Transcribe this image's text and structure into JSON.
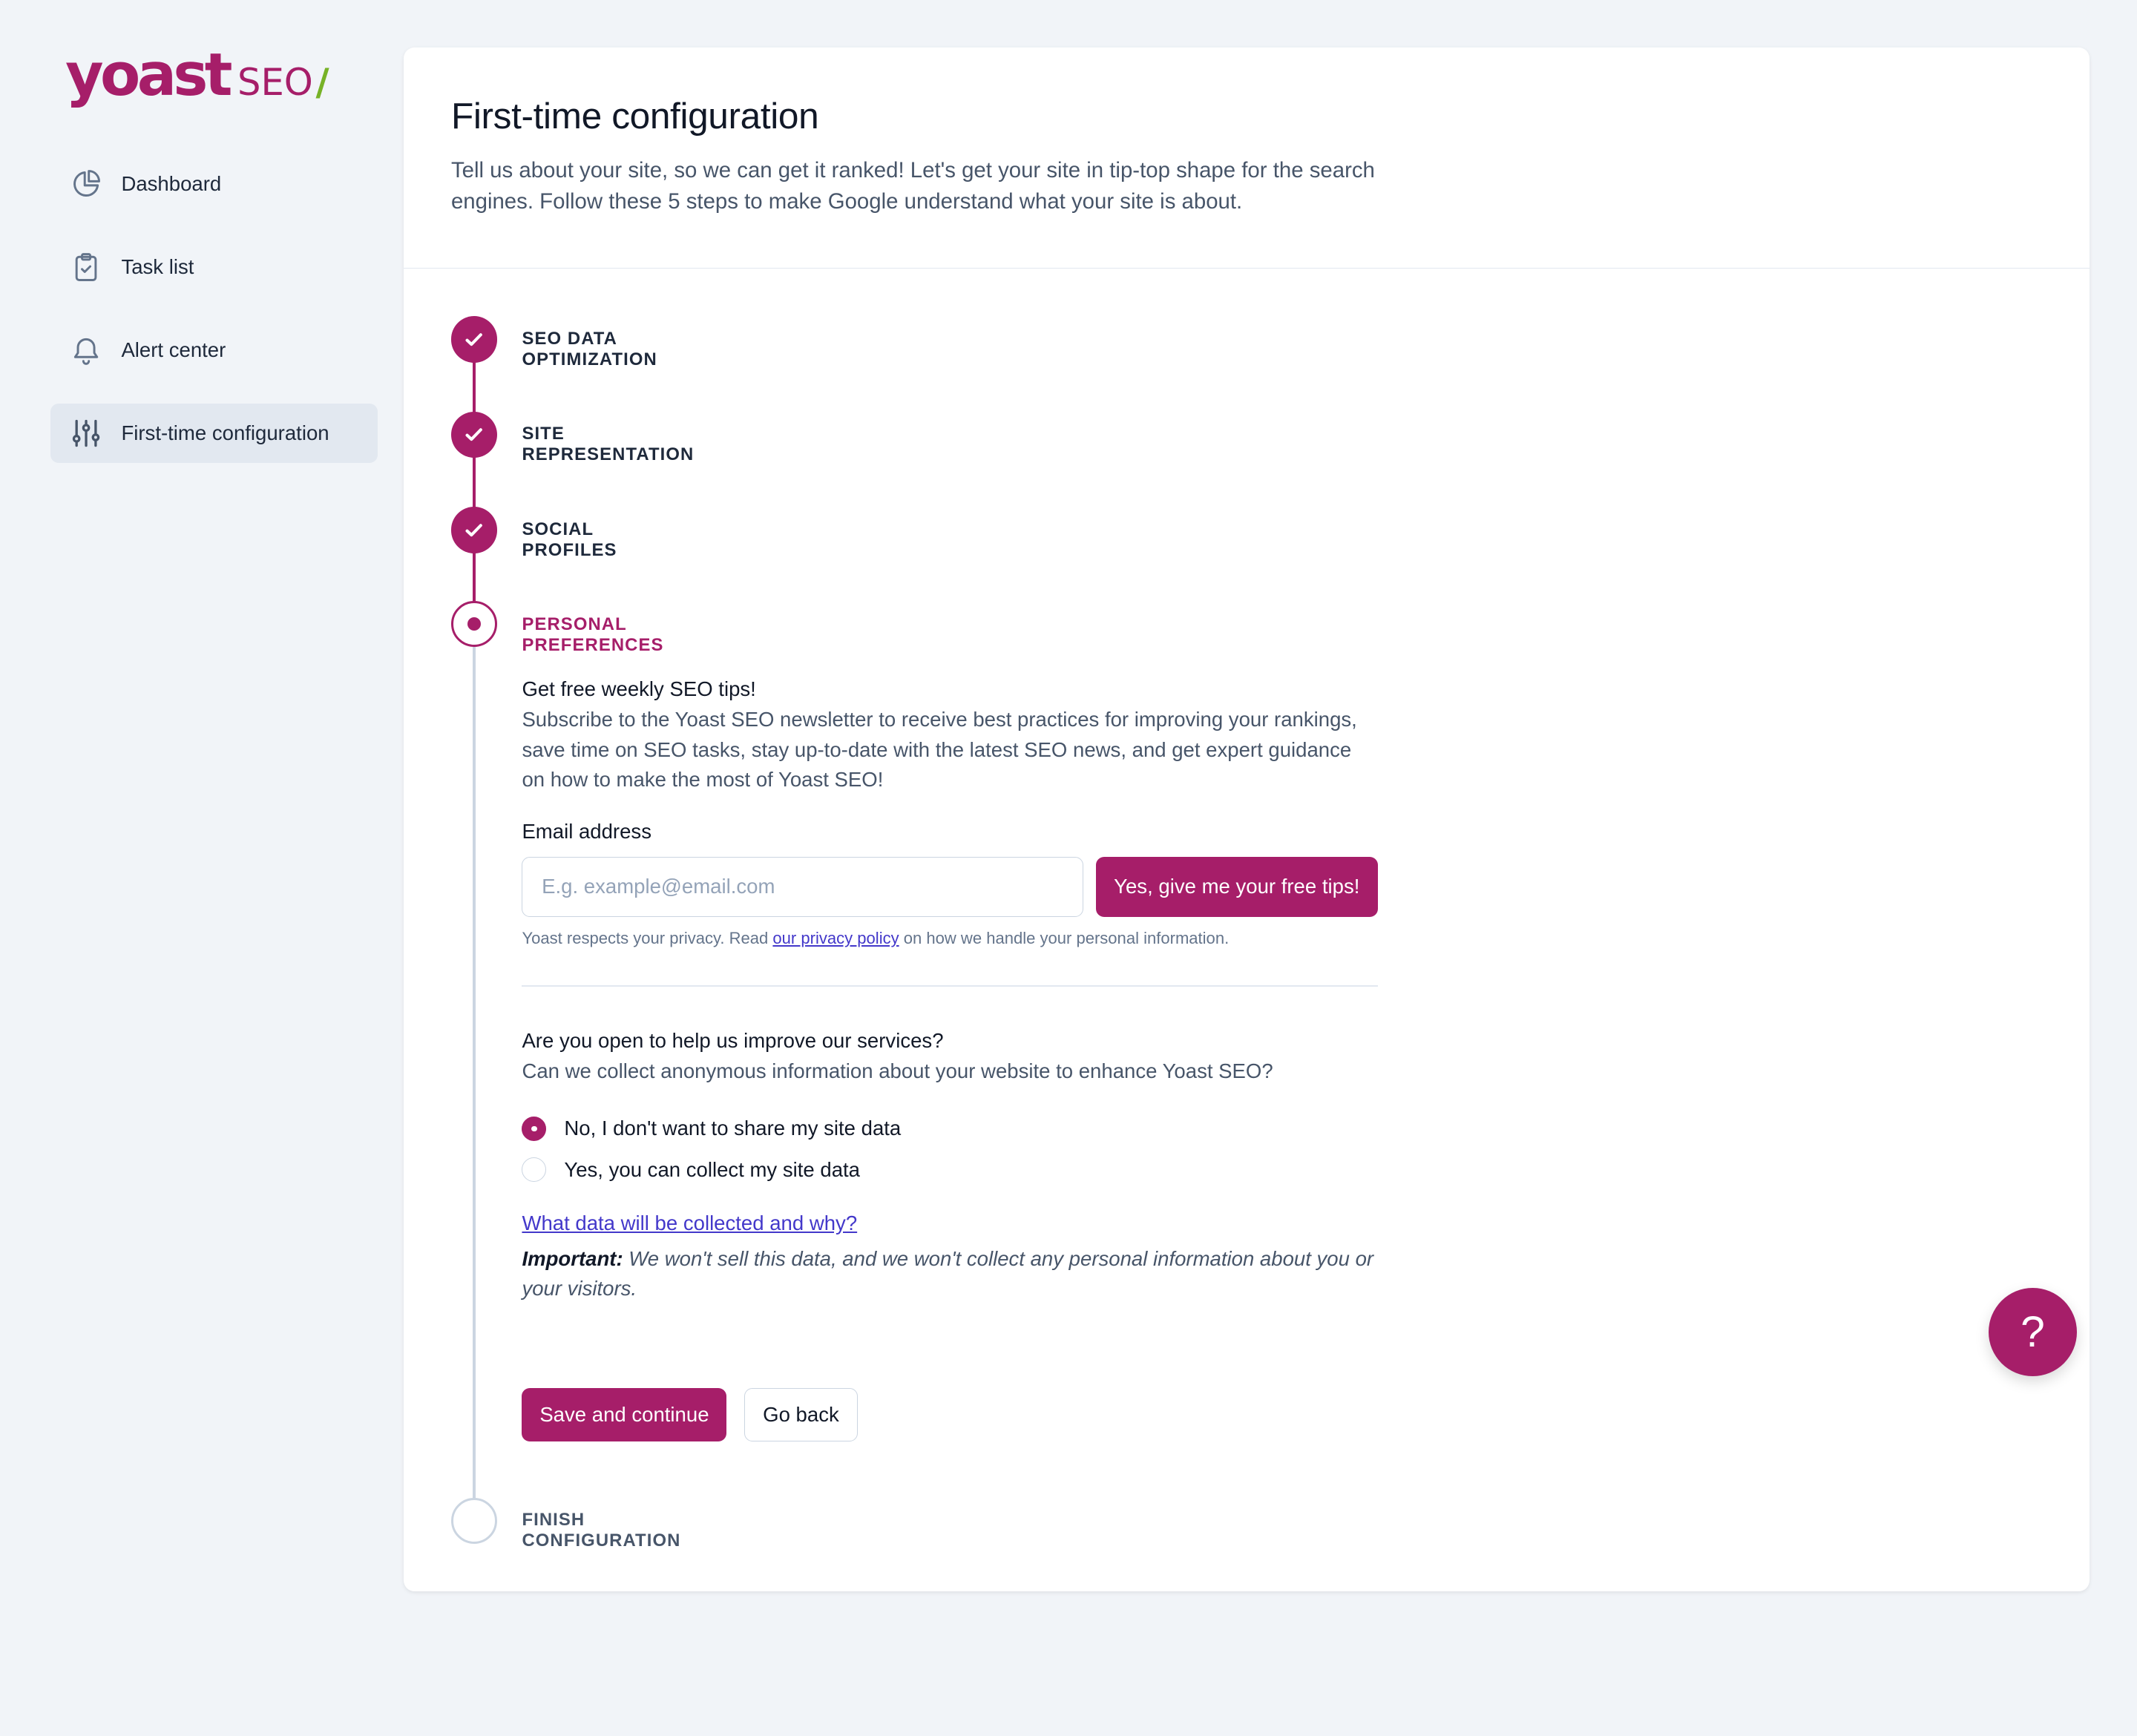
{
  "brand": {
    "name": "yoast",
    "product": "SEO",
    "slash": "/",
    "accent": "#a61e69",
    "slash_color": "#77b227"
  },
  "sidebar": {
    "items": [
      {
        "label": "Dashboard",
        "icon": "pie-chart-icon",
        "active": false
      },
      {
        "label": "Task list",
        "icon": "clipboard-check-icon",
        "active": false
      },
      {
        "label": "Alert center",
        "icon": "bell-icon",
        "active": false
      },
      {
        "label": "First-time configuration",
        "icon": "sliders-icon",
        "active": true
      }
    ]
  },
  "header": {
    "title": "First-time configuration",
    "description": "Tell us about your site, so we can get it ranked! Let's get your site in tip-top shape for the search engines. Follow these 5 steps to make Google understand what your site is about."
  },
  "steps": [
    {
      "label": "SEO DATA OPTIMIZATION",
      "status": "done"
    },
    {
      "label": "SITE REPRESENTATION",
      "status": "done"
    },
    {
      "label": "SOCIAL PROFILES",
      "status": "done"
    },
    {
      "label": "PERSONAL PREFERENCES",
      "status": "current"
    },
    {
      "label": "FINISH CONFIGURATION",
      "status": "todo"
    }
  ],
  "newsletter": {
    "heading": "Get free weekly SEO tips!",
    "body": "Subscribe to the Yoast SEO newsletter to receive best practices for improving your rankings, save time on SEO tasks, stay up-to-date with the latest SEO news, and get expert guidance on how to make the most of Yoast SEO!",
    "email_label": "Email address",
    "email_placeholder": "E.g. example@email.com",
    "email_value": "",
    "submit_label": "Yes, give me your free tips!",
    "privacy_before": "Yoast respects your privacy. Read ",
    "privacy_link": "our privacy policy",
    "privacy_after": " on how we handle your personal information."
  },
  "tracking": {
    "heading": "Are you open to help us improve our services?",
    "question": "Can we collect anonymous information about your website to enhance Yoast SEO?",
    "options": [
      {
        "label": "No, I don't want to share my site data",
        "selected": true
      },
      {
        "label": "Yes, you can collect my site data",
        "selected": false
      }
    ],
    "link": "What data will be collected and why?",
    "important_label": "Important:",
    "important_text": " We won't sell this data, and we won't collect any personal information about you or your visitors."
  },
  "actions": {
    "save_label": "Save and continue",
    "back_label": "Go back"
  },
  "help": {
    "label": "?",
    "icon": "question-icon"
  }
}
